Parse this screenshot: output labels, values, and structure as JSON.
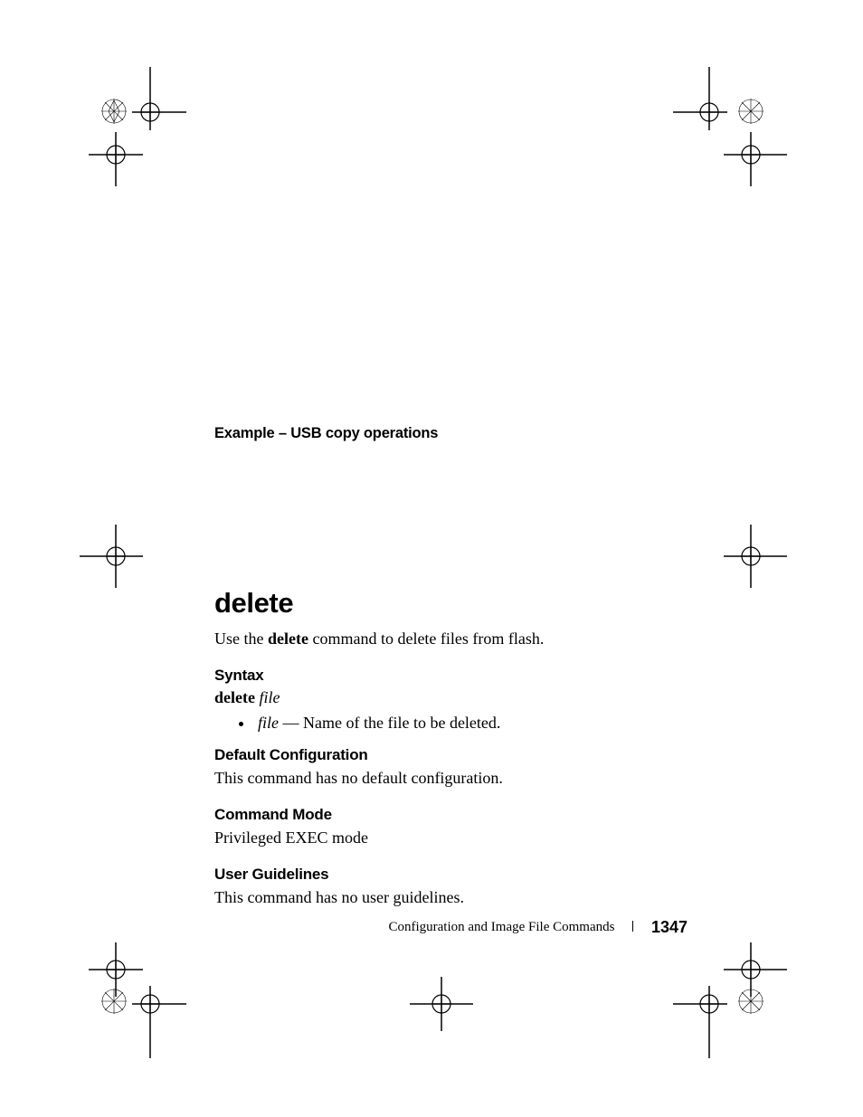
{
  "example_heading": "Example – USB copy operations",
  "command_title": "delete",
  "intro_prefix": "Use the ",
  "intro_cmd": "delete",
  "intro_suffix": " command to delete files from flash.",
  "sections": {
    "syntax": {
      "heading": "Syntax",
      "line_bold": "delete",
      "line_italic": "file",
      "bullet_term": "file",
      "bullet_desc": " — Name of the file to be deleted."
    },
    "default_config": {
      "heading": "Default Configuration",
      "text": "This command has no default configuration."
    },
    "command_mode": {
      "heading": "Command Mode",
      "text": "Privileged EXEC mode"
    },
    "user_guidelines": {
      "heading": "User Guidelines",
      "text": "This command has no user guidelines."
    }
  },
  "footer": {
    "section_name": "Configuration and Image File Commands",
    "page_number": "1347"
  }
}
